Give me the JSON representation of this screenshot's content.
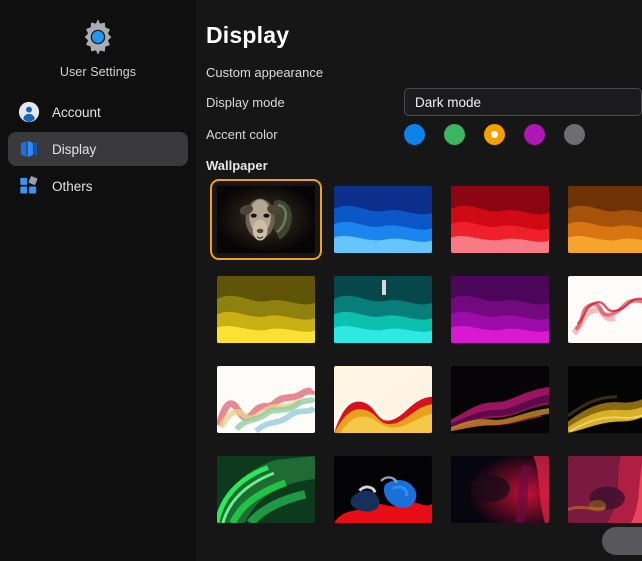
{
  "sidebar": {
    "brand": {
      "icon": "gear-icon",
      "label": "User Settings"
    },
    "items": [
      {
        "icon": "account-icon",
        "label": "Account",
        "active": false
      },
      {
        "icon": "display-icon",
        "label": "Display",
        "active": true
      },
      {
        "icon": "others-icon",
        "label": "Others",
        "active": false
      }
    ]
  },
  "main": {
    "title": "Display",
    "custom_appearance_label": "Custom appearance",
    "display_mode": {
      "label": "Display mode",
      "value": "Dark mode",
      "icon": "chevron-down-icon"
    },
    "accent_color": {
      "label": "Accent color",
      "swatches": [
        {
          "name": "blue",
          "color": "#0a84e8",
          "selected": false
        },
        {
          "name": "green",
          "color": "#3cb560",
          "selected": false
        },
        {
          "name": "orange",
          "color": "#f5a000",
          "selected": true
        },
        {
          "name": "purple",
          "color": "#ad18b5",
          "selected": false
        },
        {
          "name": "gray",
          "color": "#6e6e70",
          "selected": false
        }
      ]
    },
    "wallpaper": {
      "label": "Wallpaper",
      "tiles": [
        {
          "name": "goat-portrait",
          "style": "photo-goat",
          "selected": true
        },
        {
          "name": "blue-waves",
          "style": "waves-blue",
          "selected": false
        },
        {
          "name": "red-waves",
          "style": "waves-red",
          "selected": false
        },
        {
          "name": "orange-waves",
          "style": "waves-orange",
          "selected": false
        },
        {
          "name": "yellow-waves",
          "style": "waves-yellow",
          "selected": false
        },
        {
          "name": "teal-waves",
          "style": "waves-teal",
          "selected": false
        },
        {
          "name": "magenta-waves",
          "style": "waves-magenta",
          "selected": false
        },
        {
          "name": "red-smoke-white",
          "style": "smoke-red-white",
          "selected": false
        },
        {
          "name": "pastel-ribbons",
          "style": "ribbon-pastel",
          "selected": false
        },
        {
          "name": "fire-ribbons",
          "style": "ribbon-fire",
          "selected": false
        },
        {
          "name": "dark-magenta-silk",
          "style": "silk-magenta",
          "selected": false
        },
        {
          "name": "dark-gold-silk",
          "style": "silk-gold",
          "selected": false
        },
        {
          "name": "green-swirl",
          "style": "swirl-green",
          "selected": false
        },
        {
          "name": "red-blue-splash",
          "style": "splash-redblue",
          "selected": false
        },
        {
          "name": "dark-crimson",
          "style": "dark-crimson",
          "selected": false
        },
        {
          "name": "pink-marble",
          "style": "marble-pink",
          "selected": false
        }
      ]
    },
    "floating_button": {
      "name": "scroll-action-button",
      "label": ""
    }
  }
}
